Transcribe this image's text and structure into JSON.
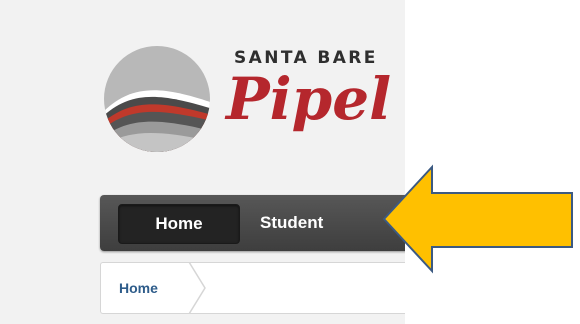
{
  "logo": {
    "top_text": "SANTA BARE",
    "main_text": "Pipel",
    "colors": {
      "red": "#b5272d",
      "dark_gray": "#4a4a4a",
      "light_gray": "#b3b3b3"
    }
  },
  "navbar": {
    "items": [
      {
        "label": "Home",
        "active": true
      },
      {
        "label": "Student",
        "active": false
      }
    ]
  },
  "breadcrumb": {
    "items": [
      {
        "label": "Home"
      }
    ]
  },
  "annotation": {
    "arrow_icon": "left-arrow-icon",
    "color": "#ffc000",
    "outline": "#3c5a82"
  }
}
